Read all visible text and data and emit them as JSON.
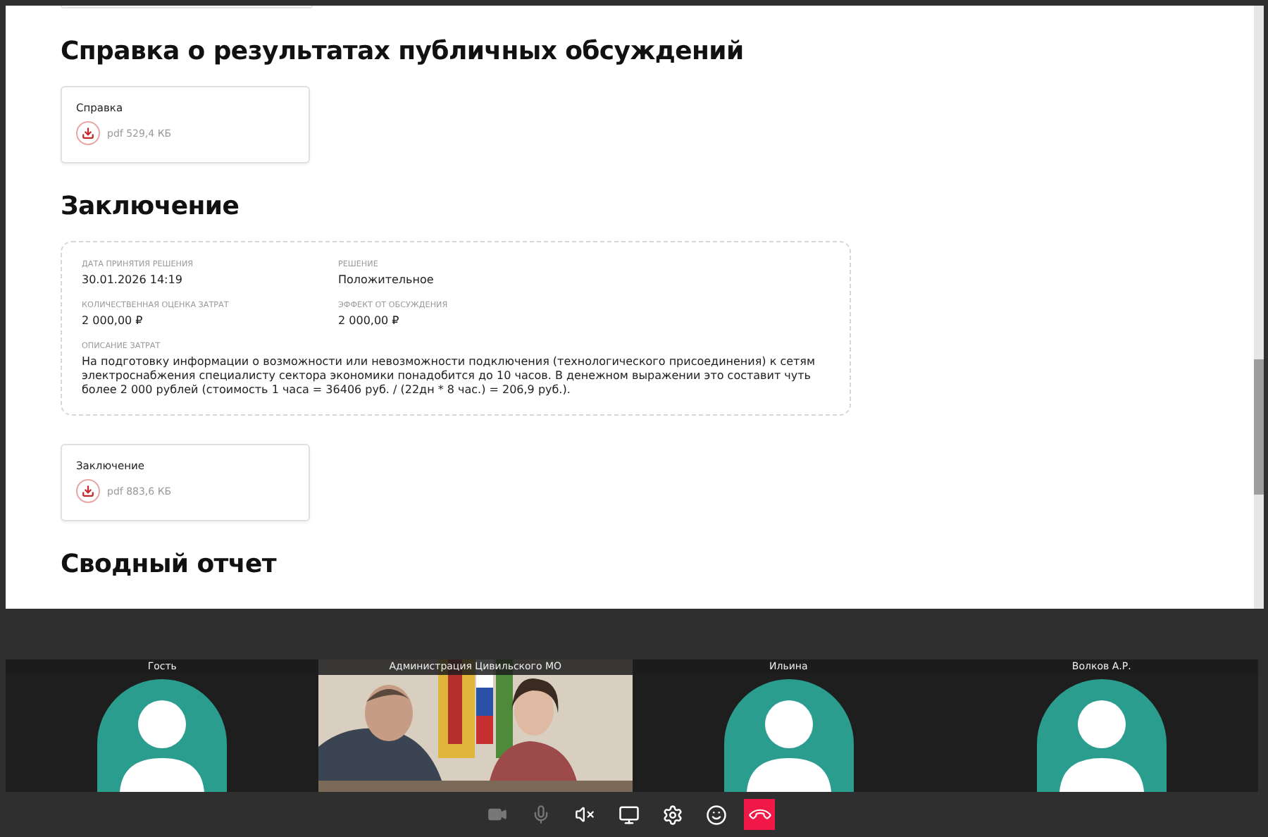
{
  "document": {
    "sections": [
      {
        "kind": "files",
        "title": "Справка о результатах публичных обсуждений",
        "files": [
          {
            "name": "Справка",
            "meta": "pdf 529,4 КБ"
          }
        ]
      },
      {
        "kind": "details",
        "title": "Заключение",
        "fields": [
          {
            "label": "ДАТА ПРИНЯТИЯ РЕШЕНИЯ",
            "value": "30.01.2026 14:19"
          },
          {
            "label": "РЕШЕНИЕ",
            "value": "Положительное"
          },
          {
            "label": "КОЛИЧЕСТВЕННАЯ ОЦЕНКА ЗАТРАТ",
            "value": "2 000,00 ₽"
          },
          {
            "label": "ЭФФЕКТ ОТ ОБСУЖДЕНИЯ",
            "value": "2 000,00 ₽"
          }
        ],
        "description": {
          "label": "ОПИСАНИЕ ЗАТРАТ",
          "value": "На подготовку информации о возможности или невозможности подключения (технологического присоединения) к сетям электроснабжения специалисту сектора экономики понадобится до 10 часов. В денежном выражении это составит чуть более 2 000 рублей (стоимость 1 часа = 36406 руб. / (22дн * 8 час.) = 206,9 руб.)."
        },
        "files": [
          {
            "name": "Заключение",
            "meta": "pdf 883,6 КБ"
          }
        ]
      },
      {
        "kind": "heading",
        "title": "Сводный отчет"
      }
    ]
  },
  "participants": [
    {
      "name": "Гость",
      "kind": "avatar"
    },
    {
      "name": "Администрация Цивильского МО",
      "kind": "video"
    },
    {
      "name": "Ильина",
      "kind": "avatar"
    },
    {
      "name": "Волков А.Р.",
      "kind": "avatar"
    }
  ],
  "controls": [
    {
      "kind": "camera",
      "disabled": true
    },
    {
      "kind": "microphone",
      "disabled": true
    },
    {
      "kind": "speaker-muted",
      "disabled": false
    },
    {
      "kind": "screen",
      "disabled": false
    },
    {
      "kind": "settings",
      "disabled": false
    },
    {
      "kind": "reaction",
      "disabled": false
    },
    {
      "kind": "hangup",
      "disabled": false
    }
  ]
}
